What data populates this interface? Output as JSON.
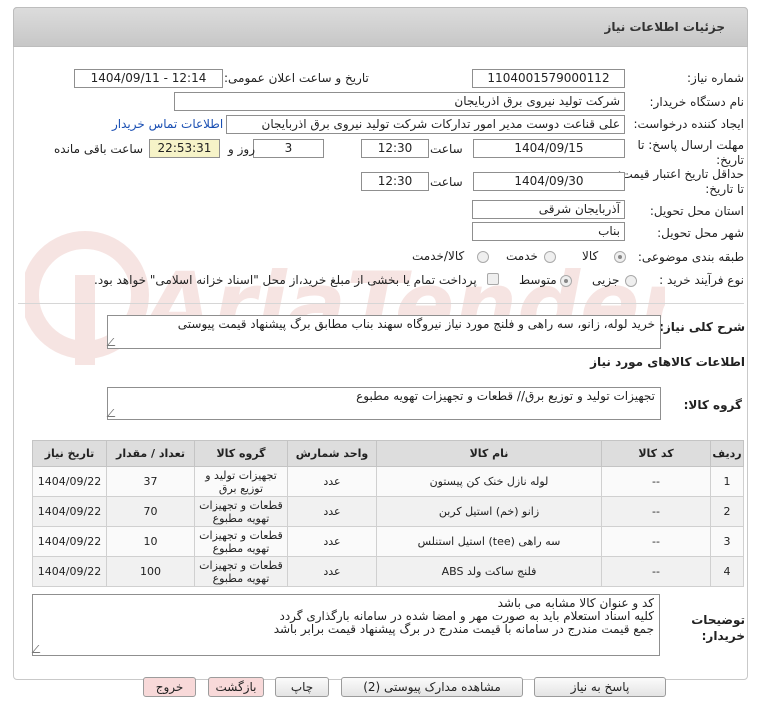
{
  "header": {
    "title": "جزئیات اطلاعات نیاز"
  },
  "form": {
    "need_number_label": "شماره نیاز:",
    "need_number": "1104001579000112",
    "announce_label": "تاریخ و ساعت اعلان عمومی:",
    "announce_value": "1404/09/11 - 12:14",
    "buyer_org_label": "نام دستگاه خریدار:",
    "buyer_org": "شرکت تولید نیروی برق اذربایجان",
    "creator_label": "ایجاد کننده درخواست:",
    "creator": "علی قناعت دوست مدیر امور تدارکات شرکت تولید نیروی برق اذربایجان",
    "contact_link": "اطلاعات تماس خریدار",
    "reply_deadline_label": "مهلت ارسال پاسخ: تا تاریخ:",
    "reply_date": "1404/09/15",
    "time_label": "ساعت",
    "reply_time": "12:30",
    "days_value": "3",
    "days_label": "روز و",
    "remaining_time": "22:53:31",
    "remaining_label": "ساعت باقی مانده",
    "validity_label": "حداقل تاریخ اعتبار قیمت: تا تاریخ:",
    "validity_date": "1404/09/30",
    "validity_time": "12:30",
    "province_label": "استان محل تحویل:",
    "province": "آذربایجان شرقی",
    "city_label": "شهر محل تحویل:",
    "city": "بناب",
    "category_label": "طبقه بندی موضوعی:",
    "category_options": [
      "کالا",
      "خدمت",
      "کالا/خدمت"
    ],
    "category_selected": "کالا",
    "purchase_type_label": "نوع فرآیند خرید :",
    "purchase_options": [
      "جزیی",
      "متوسط"
    ],
    "payment_note": "پرداخت تمام یا بخشی از مبلغ خرید،از محل \"اسناد خزانه اسلامی\" خواهد بود."
  },
  "description": {
    "label": "شرح کلی نیاز:",
    "text": "خرید لوله، زانو، سه راهی و فلنج مورد نیاز نیروگاه سهند بناب مطابق برگ پیشنهاد قیمت پیوستی"
  },
  "goods_info_title": "اطلاعات کالاهای مورد نیاز",
  "goods_group": {
    "label": "گروه کالا:",
    "text": "تجهیزات تولید و توزیع برق//  قطعات و تجهیزات تهویه مطبوع"
  },
  "table": {
    "headers": [
      "ردیف",
      "کد کالا",
      "نام کالا",
      "واحد شمارش",
      "گروه کالا",
      "تعداد / مقدار",
      "تاریخ نیاز"
    ],
    "rows": [
      [
        "1",
        "--",
        "لوله نازل خنک کن پیستون",
        "عدد",
        "تجهیزات تولید و توزیع برق",
        "37",
        "1404/09/22"
      ],
      [
        "2",
        "--",
        "زانو (خم) استیل کربن",
        "عدد",
        "قطعات و تجهیزات تهویه مطبوع",
        "70",
        "1404/09/22"
      ],
      [
        "3",
        "--",
        "سه راهی (tee) استیل استنلس",
        "عدد",
        "قطعات و تجهیزات تهویه مطبوع",
        "10",
        "1404/09/22"
      ],
      [
        "4",
        "--",
        "فلنج ساکت ولد ABS",
        "عدد",
        "قطعات و تجهیزات تهویه مطبوع",
        "100",
        "1404/09/22"
      ]
    ]
  },
  "buyer_notes": {
    "label": "توضیحات خریدار:",
    "lines": [
      "کد و عنوان کالا مشابه می باشد",
      "کلیه اسناد استعلام باید به صورت مهر و امضا شده در سامانه بارگذاری گردد",
      "جمع قیمت مندرج در سامانه با قیمت مندرج در برگ پیشنهاد قیمت برابر باشد"
    ]
  },
  "buttons": {
    "reply": "پاسخ به نیاز",
    "view_docs": "مشاهده مدارک پیوستی (2)",
    "print": "چاپ",
    "back": "بازگشت",
    "exit": "خروج"
  },
  "watermark_text": "AriaTender.net"
}
